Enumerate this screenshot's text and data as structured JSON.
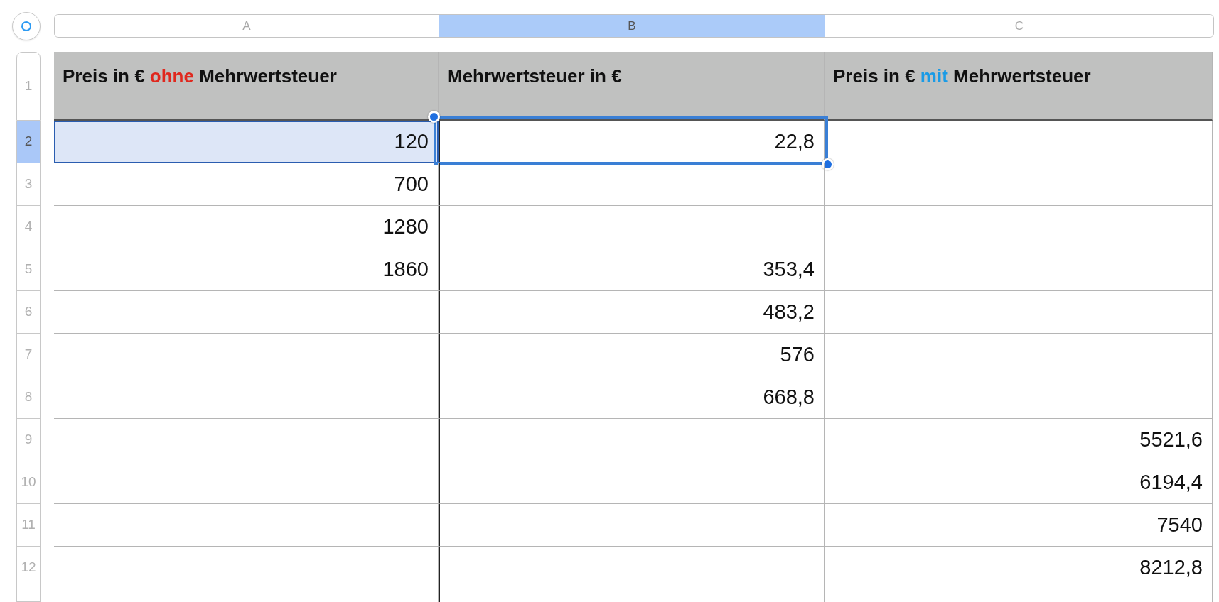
{
  "columns": [
    {
      "label": "A",
      "selected": false
    },
    {
      "label": "B",
      "selected": true
    },
    {
      "label": "C",
      "selected": false
    }
  ],
  "rows": [
    {
      "number": "1",
      "kind": "header",
      "selected": false,
      "cells": [
        {
          "segments": [
            {
              "text": "Preis in € "
            },
            {
              "text": "ohne",
              "color": "#e0281e"
            },
            {
              "text": " Mehrwertsteuer"
            }
          ],
          "highlighted": false,
          "active": false
        },
        {
          "segments": [
            {
              "text": "Mehrwertsteuer in €"
            }
          ],
          "highlighted": false,
          "active": false
        },
        {
          "segments": [
            {
              "text": "Preis in € "
            },
            {
              "text": "mit",
              "color": "#1a9be6"
            },
            {
              "text": " Mehrwertsteuer"
            }
          ],
          "highlighted": false,
          "active": false
        }
      ]
    },
    {
      "number": "2",
      "kind": "data",
      "selected": true,
      "cells": [
        {
          "value": "120",
          "highlighted": true,
          "active": false
        },
        {
          "value": "22,8",
          "highlighted": false,
          "active": true
        },
        {
          "highlighted": false,
          "active": false
        }
      ]
    },
    {
      "number": "3",
      "kind": "data",
      "selected": false,
      "cells": [
        {
          "value": "700",
          "highlighted": false,
          "active": false
        },
        {
          "highlighted": false,
          "active": false
        },
        {
          "highlighted": false,
          "active": false
        }
      ]
    },
    {
      "number": "4",
      "kind": "data",
      "selected": false,
      "cells": [
        {
          "value": "1280",
          "highlighted": false,
          "active": false
        },
        {
          "highlighted": false,
          "active": false
        },
        {
          "highlighted": false,
          "active": false
        }
      ]
    },
    {
      "number": "5",
      "kind": "data",
      "selected": false,
      "cells": [
        {
          "value": "1860",
          "highlighted": false,
          "active": false
        },
        {
          "value": "353,4",
          "highlighted": false,
          "active": false
        },
        {
          "highlighted": false,
          "active": false
        }
      ]
    },
    {
      "number": "6",
      "kind": "data",
      "selected": false,
      "cells": [
        {
          "highlighted": false,
          "active": false
        },
        {
          "value": "483,2",
          "highlighted": false,
          "active": false
        },
        {
          "highlighted": false,
          "active": false
        }
      ]
    },
    {
      "number": "7",
      "kind": "data",
      "selected": false,
      "cells": [
        {
          "highlighted": false,
          "active": false
        },
        {
          "value": "576",
          "highlighted": false,
          "active": false
        },
        {
          "highlighted": false,
          "active": false
        }
      ]
    },
    {
      "number": "8",
      "kind": "data",
      "selected": false,
      "cells": [
        {
          "highlighted": false,
          "active": false
        },
        {
          "value": "668,8",
          "highlighted": false,
          "active": false
        },
        {
          "highlighted": false,
          "active": false
        }
      ]
    },
    {
      "number": "9",
      "kind": "data",
      "selected": false,
      "cells": [
        {
          "highlighted": false,
          "active": false
        },
        {
          "highlighted": false,
          "active": false
        },
        {
          "value": "5521,6",
          "highlighted": false,
          "active": false
        }
      ]
    },
    {
      "number": "10",
      "kind": "data",
      "selected": false,
      "cells": [
        {
          "highlighted": false,
          "active": false
        },
        {
          "highlighted": false,
          "active": false
        },
        {
          "value": "6194,4",
          "highlighted": false,
          "active": false
        }
      ]
    },
    {
      "number": "11",
      "kind": "data",
      "selected": false,
      "cells": [
        {
          "highlighted": false,
          "active": false
        },
        {
          "highlighted": false,
          "active": false
        },
        {
          "value": "7540",
          "highlighted": false,
          "active": false
        }
      ]
    },
    {
      "number": "12",
      "kind": "data",
      "selected": false,
      "cells": [
        {
          "highlighted": false,
          "active": false
        },
        {
          "highlighted": false,
          "active": false
        },
        {
          "value": "8212,8",
          "highlighted": false,
          "active": false
        }
      ]
    }
  ]
}
